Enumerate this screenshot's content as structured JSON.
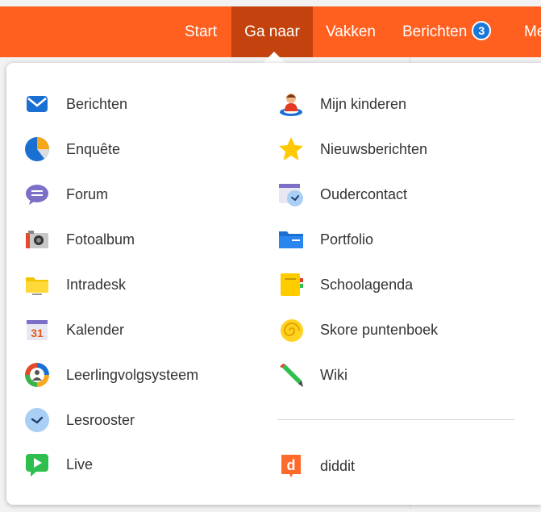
{
  "nav": {
    "items": [
      {
        "label": "Start"
      },
      {
        "label": "Ga naar"
      },
      {
        "label": "Vakken"
      },
      {
        "label": "Berichten",
        "badge": "3"
      },
      {
        "label": "Me"
      }
    ]
  },
  "menu": {
    "left": [
      {
        "label": "Berichten",
        "icon": "envelope-icon"
      },
      {
        "label": "Enquête",
        "icon": "pie-chart-icon"
      },
      {
        "label": "Forum",
        "icon": "speech-bubble-icon"
      },
      {
        "label": "Fotoalbum",
        "icon": "camera-icon"
      },
      {
        "label": "Intradesk",
        "icon": "folder-icon"
      },
      {
        "label": "Kalender",
        "icon": "calendar-icon",
        "icon_text": "31"
      },
      {
        "label": "Leerlingvolgsysteem",
        "icon": "student-tracking-icon"
      },
      {
        "label": "Lesrooster",
        "icon": "clock-icon"
      },
      {
        "label": "Live",
        "icon": "live-play-icon"
      }
    ],
    "right": [
      {
        "label": "Mijn kinderen",
        "icon": "child-icon"
      },
      {
        "label": "Nieuwsberichten",
        "icon": "star-icon"
      },
      {
        "label": "Oudercontact",
        "icon": "calendar-clock-icon"
      },
      {
        "label": "Portfolio",
        "icon": "blue-folder-icon"
      },
      {
        "label": "Schoolagenda",
        "icon": "agenda-icon"
      },
      {
        "label": "Skore puntenboek",
        "icon": "shell-icon"
      },
      {
        "label": "Wiki",
        "icon": "pencil-icon"
      }
    ],
    "extra": [
      {
        "label": "diddit",
        "icon": "diddit-icon",
        "icon_text": "d"
      }
    ]
  },
  "colors": {
    "topbar": "#ff5f1f",
    "active_tab": "#c3420d",
    "badge": "#1c78d8"
  }
}
